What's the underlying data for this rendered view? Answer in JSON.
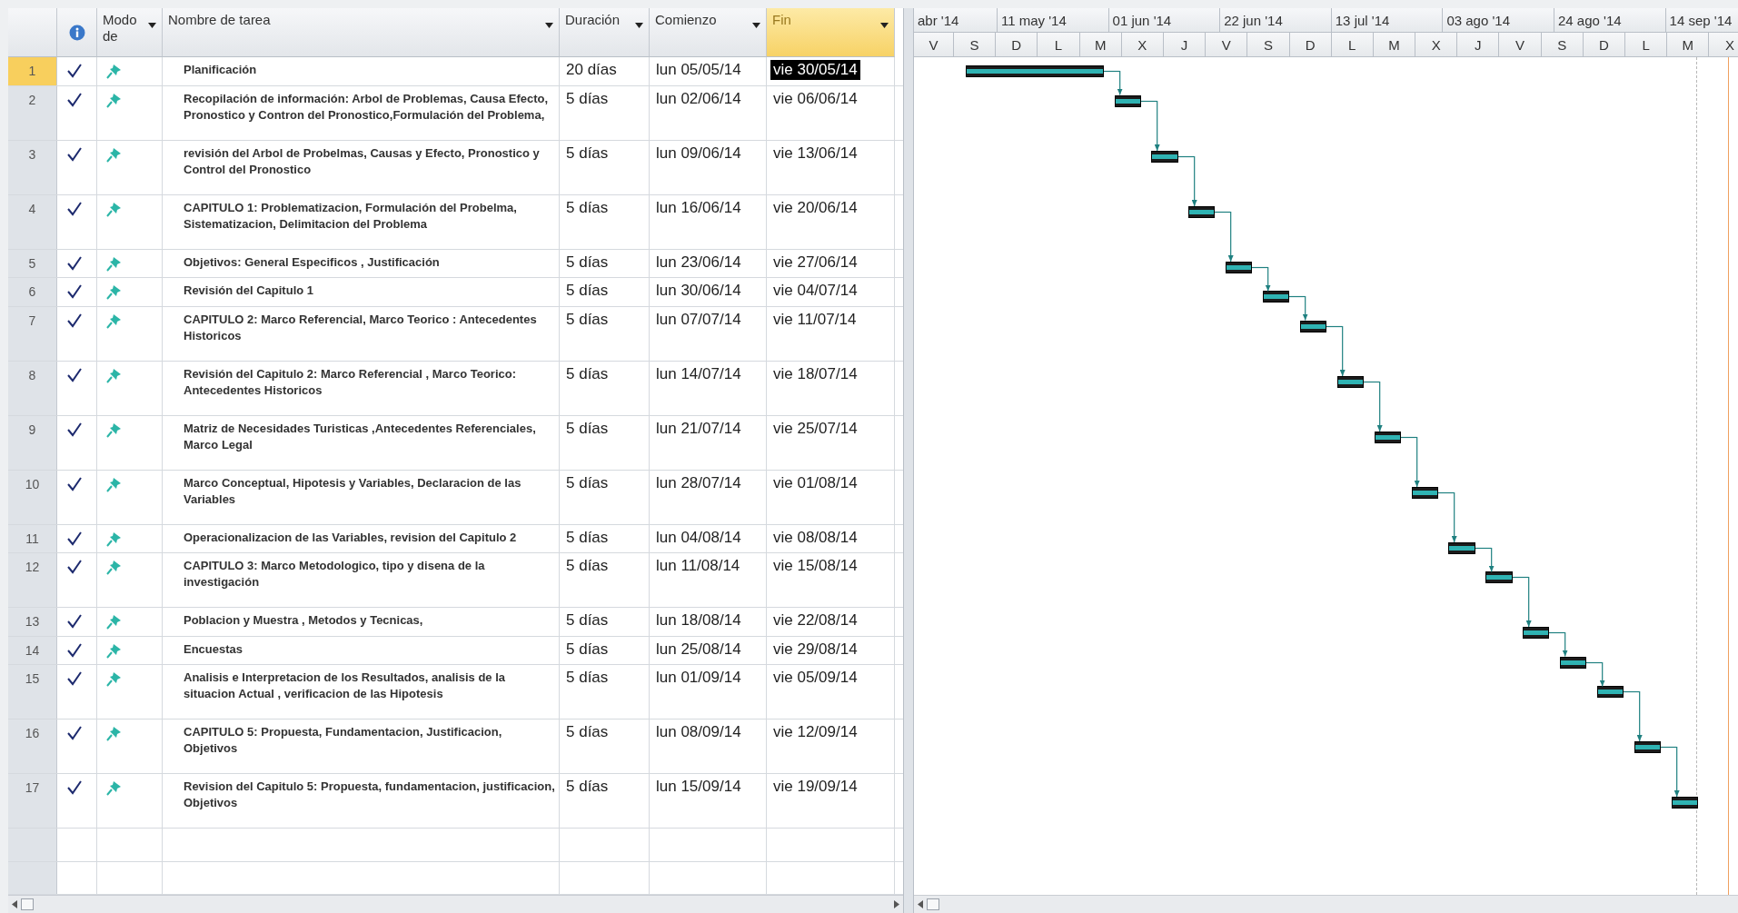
{
  "columns": [
    {
      "label": "Modo de",
      "selected": false
    },
    {
      "label": "Nombre de tarea",
      "selected": false
    },
    {
      "label": "Duración",
      "selected": false
    },
    {
      "label": "Comienzo",
      "selected": false
    },
    {
      "label": "Fin",
      "selected": true
    }
  ],
  "timescale": {
    "top": [
      "abr '14",
      "11 may '14",
      "01 jun '14",
      "22 jun '14",
      "13 jul '14",
      "03 ago '14",
      "24 ago '14",
      "14 sep '14"
    ],
    "bottom": [
      "V",
      "S",
      "D",
      "L",
      "M",
      "X",
      "J",
      "V",
      "S",
      "D",
      "L",
      "M",
      "X",
      "J",
      "V",
      "S",
      "D",
      "L",
      "M",
      "X"
    ]
  },
  "tasks": [
    {
      "id": "1",
      "name": "Planificación",
      "duration": "20 días",
      "start": "lun 05/05/14",
      "finish": "vie 30/05/14",
      "complete": true,
      "selected": true
    },
    {
      "id": "2",
      "name": "Recopilación de información: Arbol de Problemas, Causa Efecto, Pronostico y Contron del Pronostico,Formulación del Problema,",
      "duration": "5 días",
      "start": "lun 02/06/14",
      "finish": "vie 06/06/14",
      "complete": true,
      "selected": false
    },
    {
      "id": "3",
      "name": "revisión del Arbol de Probelmas, Causas y Efecto, Pronostico y Control del Pronostico",
      "duration": "5 días",
      "start": "lun 09/06/14",
      "finish": "vie 13/06/14",
      "complete": true,
      "selected": false
    },
    {
      "id": "4",
      "name": "CAPITULO 1: Problematizacion, Formulación del Probelma, Sistematizacion, Delimitacion del Problema",
      "duration": "5 días",
      "start": "lun 16/06/14",
      "finish": "vie 20/06/14",
      "complete": true,
      "selected": false
    },
    {
      "id": "5",
      "name": "Objetivos: General Especificos , Justificación",
      "duration": "5 días",
      "start": "lun 23/06/14",
      "finish": "vie 27/06/14",
      "complete": true,
      "selected": false
    },
    {
      "id": "6",
      "name": "Revisión del Capitulo 1",
      "duration": "5 días",
      "start": "lun 30/06/14",
      "finish": "vie 04/07/14",
      "complete": true,
      "selected": false
    },
    {
      "id": "7",
      "name": "CAPITULO 2: Marco Referencial, Marco Teorico : Antecedentes Historicos",
      "duration": "5 días",
      "start": "lun 07/07/14",
      "finish": "vie 11/07/14",
      "complete": true,
      "selected": false
    },
    {
      "id": "8",
      "name": "Revisión del Capitulo 2: Marco Referencial , Marco Teorico: Antecedentes Historicos",
      "duration": "5 días",
      "start": "lun 14/07/14",
      "finish": "vie 18/07/14",
      "complete": true,
      "selected": false
    },
    {
      "id": "9",
      "name": "Matriz de Necesidades Turisticas ,Antecedentes Referenciales, Marco Legal",
      "duration": "5 días",
      "start": "lun 21/07/14",
      "finish": "vie 25/07/14",
      "complete": true,
      "selected": false
    },
    {
      "id": "10",
      "name": "Marco Conceptual, Hipotesis y Variables, Declaracion de las Variables",
      "duration": "5 días",
      "start": "lun 28/07/14",
      "finish": "vie 01/08/14",
      "complete": true,
      "selected": false
    },
    {
      "id": "11",
      "name": "Operacionalizacion de las Variables, revision del Capitulo 2",
      "duration": "5 días",
      "start": "lun 04/08/14",
      "finish": "vie 08/08/14",
      "complete": true,
      "selected": false
    },
    {
      "id": "12",
      "name": "CAPITULO 3: Marco Metodologico, tipo y disena de la investigación",
      "duration": "5 días",
      "start": "lun 11/08/14",
      "finish": "vie 15/08/14",
      "complete": true,
      "selected": false
    },
    {
      "id": "13",
      "name": "Poblacion y Muestra , Metodos y Tecnicas,",
      "duration": "5 días",
      "start": "lun 18/08/14",
      "finish": "vie 22/08/14",
      "complete": true,
      "selected": false
    },
    {
      "id": "14",
      "name": "Encuestas",
      "duration": "5 días",
      "start": "lun 25/08/14",
      "finish": "vie 29/08/14",
      "complete": true,
      "selected": false
    },
    {
      "id": "15",
      "name": "Analisis e Interpretacion de los Resultados, analisis de la situacion Actual , verificacion de las Hipotesis",
      "duration": "5 días",
      "start": "lun 01/09/14",
      "finish": "vie 05/09/14",
      "complete": true,
      "selected": false
    },
    {
      "id": "16",
      "name": "CAPITULO 5: Propuesta, Fundamentacion, Justificacion, Objetivos",
      "duration": "5 días",
      "start": "lun 08/09/14",
      "finish": "vie 12/09/14",
      "complete": true,
      "selected": false
    },
    {
      "id": "17",
      "name": "Revision del Capitulo 5: Propuesta, fundamentacion, justificacion, Objetivos",
      "duration": "5 días",
      "start": "lun 15/09/14",
      "finish": "vie 19/09/14",
      "complete": true,
      "selected": false
    }
  ]
}
